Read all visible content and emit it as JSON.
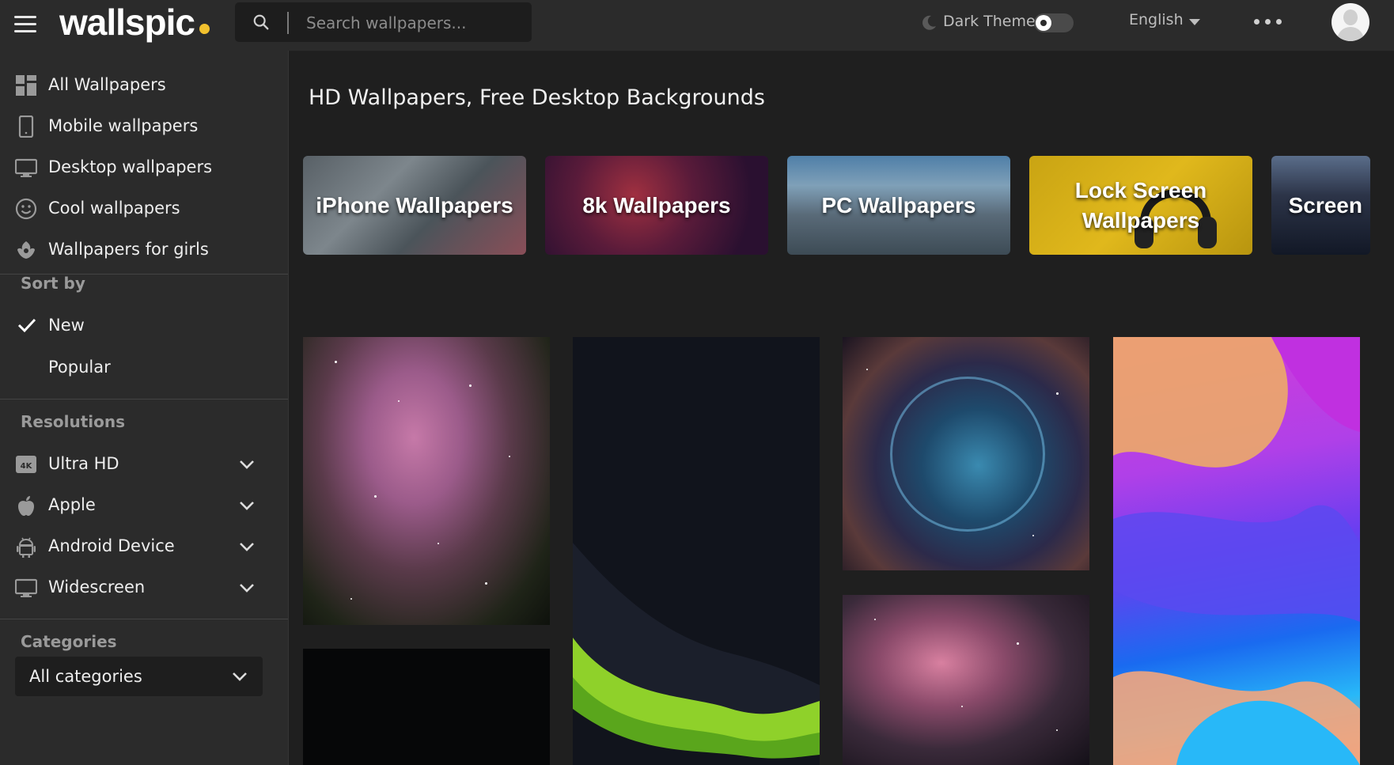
{
  "header": {
    "logo": "wallspic",
    "logo_dot_color": "#f2c12e",
    "search_placeholder": "Search wallpapers...",
    "theme_label": "Dark Theme",
    "language": "English"
  },
  "sidebar": {
    "nav": [
      {
        "label": "All Wallpapers",
        "icon": "grid-icon"
      },
      {
        "label": "Mobile wallpapers",
        "icon": "phone-icon"
      },
      {
        "label": "Desktop wallpapers",
        "icon": "monitor-icon"
      },
      {
        "label": "Cool wallpapers",
        "icon": "smiley-icon"
      },
      {
        "label": "Wallpapers for girls",
        "icon": "flower-icon"
      }
    ],
    "sort": {
      "title": "Sort by",
      "options": [
        {
          "label": "New",
          "selected": true
        },
        {
          "label": "Popular",
          "selected": false
        }
      ]
    },
    "resolutions": {
      "title": "Resolutions",
      "items": [
        {
          "label": "Ultra HD",
          "icon": "4k-icon",
          "badge": "4K"
        },
        {
          "label": "Apple",
          "icon": "apple-icon"
        },
        {
          "label": "Android Device",
          "icon": "android-icon"
        },
        {
          "label": "Widescreen",
          "icon": "monitor-icon"
        }
      ]
    },
    "categories": {
      "title": "Categories",
      "selected": "All categories"
    }
  },
  "main": {
    "title": "HD Wallpapers, Free Desktop Backgrounds",
    "category_cards": [
      {
        "label": "iPhone Wallpapers"
      },
      {
        "label": "8k Wallpapers"
      },
      {
        "label": "PC Wallpapers"
      },
      {
        "label": "Lock Screen Wallpapers"
      },
      {
        "label": "Screen"
      }
    ]
  },
  "colors": {
    "topbar": "#2b2b2b",
    "sidebar": "#2b2b2b",
    "page": "#1f1f1f",
    "accent": "#f2c12e"
  }
}
